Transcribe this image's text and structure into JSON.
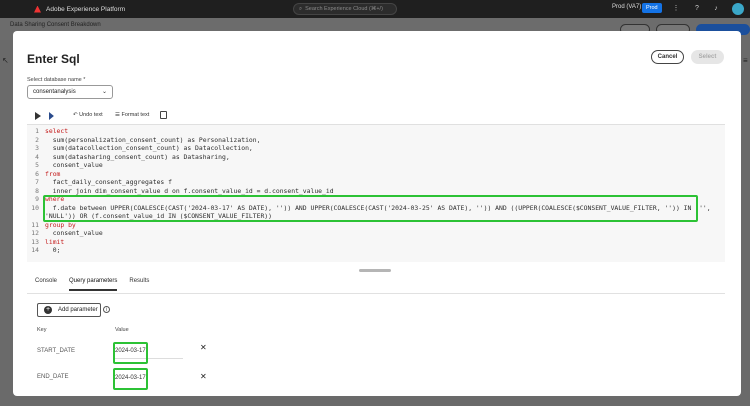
{
  "topbar": {
    "app_name": "Adobe Experience Platform",
    "search_placeholder": "Search Experience Cloud (⌘+/)",
    "env": "Prod (VA7)",
    "env_badge": "Prod"
  },
  "background": {
    "breadcrumb": "Data Sharing Consent Breakdown"
  },
  "modal": {
    "title": "Enter Sql",
    "cancel_label": "Cancel",
    "select_label": "Select",
    "db_label": "Select database name *",
    "db_value": "consentanalysis",
    "toolbar": {
      "undo_label": "Undo text",
      "format_label": "Format text"
    },
    "code_lines": [
      "select",
      "  sum(personalization_consent_count) as Personalization,",
      "  sum(datacollection_consent_count) as Datacollection,",
      "  sum(datasharing_consent_count) as Datasharing,",
      "  consent_value",
      "from",
      "  fact_daily_consent_aggregates f",
      "  inner join dim_consent_value d on f.consent_value_id = d.consent_value_id",
      "where",
      "  f.date between UPPER(COALESCE(CAST('2024-03-17' AS DATE), '')) AND UPPER(COALESCE(CAST('2024-03-25' AS DATE), '')) AND ((UPPER(COALESCE($CONSENT_VALUE_FILTER, '')) IN ('',",
      "'NULL')) OR (f.consent_value_id IN ($CONSENT_VALUE_FILTER))",
      "group by",
      "  consent_value",
      "limit",
      "  0;"
    ],
    "line_numbers": [
      "1",
      "2",
      "3",
      "4",
      "5",
      "6",
      "7",
      "8",
      "9",
      "10",
      "11",
      "12",
      "13",
      "14"
    ],
    "tabs": [
      "Console",
      "Query parameters",
      "Results"
    ],
    "active_tab": "Query parameters",
    "add_param_label": "Add parameter",
    "columns": {
      "key": "Key",
      "value": "Value"
    },
    "params": [
      {
        "key": "START_DATE",
        "value": "2024-03-17"
      },
      {
        "key": "END_DATE",
        "value": "2024-03-17"
      }
    ]
  },
  "colors": {
    "highlight_box": "#2cc235",
    "keyword": "#c31818",
    "string": "#1a6b1a",
    "accent": "#1473e6"
  }
}
